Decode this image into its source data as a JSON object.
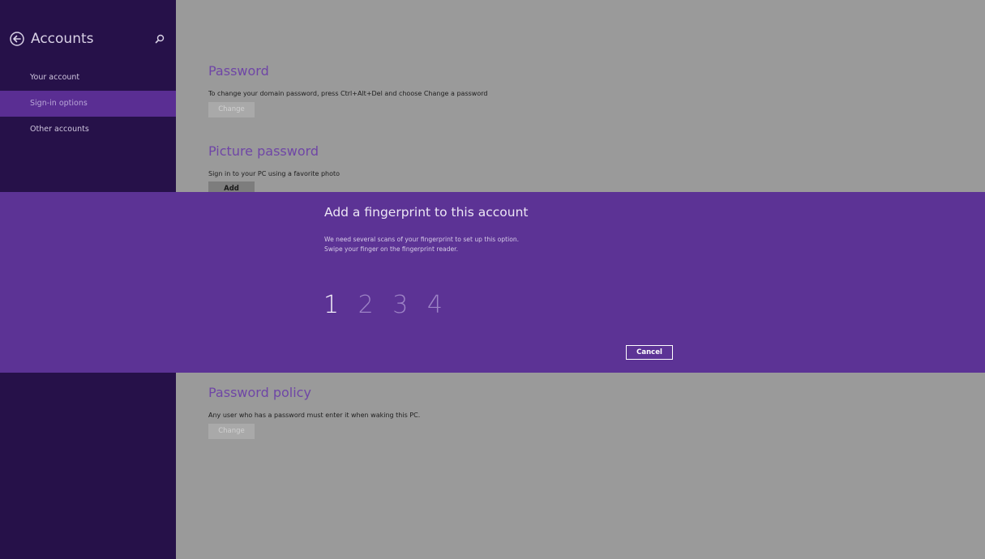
{
  "sidebar": {
    "title": "Accounts",
    "items": [
      {
        "label": "Your account"
      },
      {
        "label": "Sign-in options"
      },
      {
        "label": "Other accounts"
      }
    ]
  },
  "main": {
    "password": {
      "title": "Password",
      "description": "To change your domain password, press Ctrl+Alt+Del and choose Change a password",
      "button": "Change"
    },
    "picture_password": {
      "title": "Picture password",
      "description": "Sign in to your PC using a favorite photo",
      "button": "Add"
    },
    "password_policy": {
      "title": "Password policy",
      "description": "Any user who has a password must enter it when waking this PC.",
      "button": "Change"
    }
  },
  "dialog": {
    "title": "Add a fingerprint to this account",
    "line1": "We need several scans of your fingerprint to set up this option.",
    "line2": "Swipe your finger on the fingerprint reader.",
    "steps": [
      "1",
      "2",
      "3",
      "4"
    ],
    "cancel_label": "Cancel"
  },
  "colors": {
    "sidebar_bg": "#261149",
    "selected_bg": "#5a2e93",
    "dialog_bg": "#5c3395",
    "accent_title": "#6f46a6"
  }
}
